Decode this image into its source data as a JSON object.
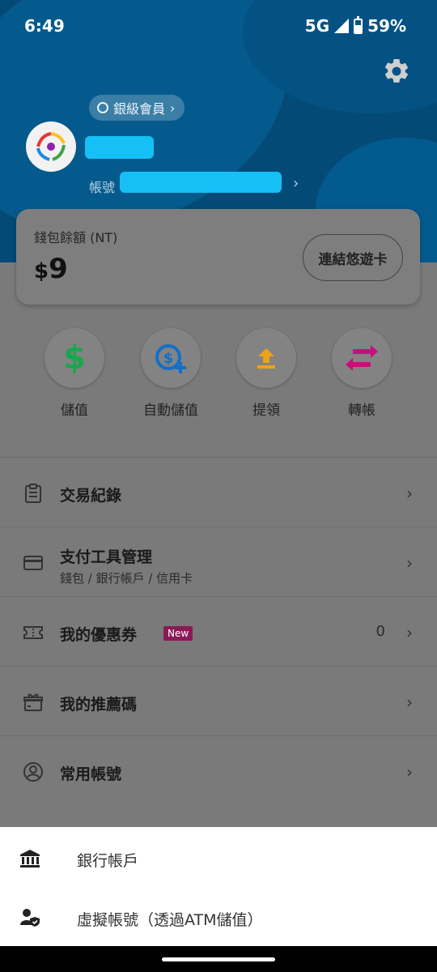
{
  "status_bar": {
    "time": "6:49",
    "network": "5G",
    "battery": "59%"
  },
  "profile": {
    "member_level": "銀級會員",
    "account_label": "帳號"
  },
  "wallet": {
    "label": "錢包餘額 (NT)",
    "currency_symbol": "$",
    "balance": "9",
    "link_card_button": "連結悠遊卡"
  },
  "actions": [
    {
      "label": "儲值",
      "icon": "dollar-icon"
    },
    {
      "label": "自動儲值",
      "icon": "auto-topup-icon"
    },
    {
      "label": "提領",
      "icon": "withdraw-icon"
    },
    {
      "label": "轉帳",
      "icon": "transfer-icon"
    }
  ],
  "menu": [
    {
      "title": "交易紀錄",
      "icon": "clipboard-icon"
    },
    {
      "title": "支付工具管理",
      "subtitle": "錢包 / 銀行帳戶 / 信用卡",
      "icon": "credit-card-icon"
    },
    {
      "title": "我的優惠券",
      "badge": "New",
      "count": "0",
      "icon": "ticket-icon"
    },
    {
      "title": "我的推薦碼",
      "icon": "gift-icon"
    },
    {
      "title": "常用帳號",
      "icon": "user-circle-icon"
    }
  ],
  "sheet": [
    {
      "label": "銀行帳戶",
      "icon": "bank-icon"
    },
    {
      "label": "虛擬帳號（透過ATM儲值）",
      "icon": "user-shield-icon"
    }
  ],
  "colors": {
    "header": "#044a77",
    "highlight_mask": "#16c0f6",
    "dollar": "#1aa64f",
    "auto_topup": "#1170c9",
    "withdraw": "#f0a11a",
    "transfer": "#c4117c",
    "new_badge": "#8a1a56"
  }
}
